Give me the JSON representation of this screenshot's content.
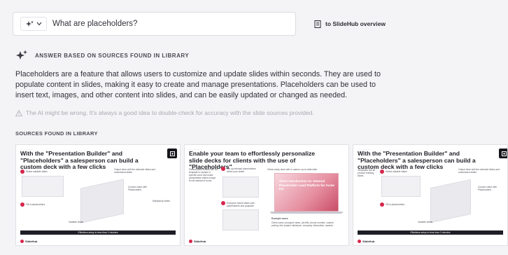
{
  "search": {
    "query": "What are placeholders?",
    "overview_link": "to SlideHub overview"
  },
  "answer": {
    "title": "ANSWER BASED ON SOURCES FOUND IN LIBRARY",
    "text": "Placeholders are a feature that allows users to customize and update slides within seconds. They are used to populate content in slides, making it easy to create and manage presentations. Placeholders can be used to insert text, images, and other content into slides, and can be easily updated or changed as needed.",
    "disclaimer": "The AI might be wrong. It's always a good idea to double-check for accuracy with the slide sources provided."
  },
  "sources": {
    "title": "SOURCES FOUND IN LIBRARY",
    "cards": [
      {
        "title": "With the \"Presentation Builder\" and \"Placeholders\" a salesperson can build a custom deck with a few clicks",
        "notes": [
          "Select suitable slides",
          "Output deck with the selected slides and customized slides",
          "Fill in placeholders",
          "Custom value with Placeholders",
          "Variable slides",
          "Mandatory slides"
        ],
        "footer": "Effortless setup in less than 2 minutes",
        "logo": "SlideHub"
      },
      {
        "title": "Enable your team to effortlessly personalize slide decks for clients with the use of \"Placeholders\"",
        "notes": [
          "Placeholders enable the 1st template to replace a specific word and make presentation slides unique for all instead of hours",
          "Set up relevant placeholders within your slides",
          "Client-ready deck with a custom, up-to-date data",
          "Everyone select slides with placeholders and populate",
          "Example cases",
          "Client name, prospect name, job title, phone number, custom pricing, firm project milestone, company information, awards"
        ],
        "slide_text": "Short introduction to: Internal Placeholder Lead Platform for Acme Inc",
        "logo": "SlideHub"
      },
      {
        "title": "With the \"Presentation Builder\" and \"Placeholders\" a salesperson can build a custom deck with a few clicks",
        "notes": [
          "Select suitable slides",
          "Output deck with the selected slides and customized slides",
          "Fill in placeholders",
          "Custom value with Placeholders",
          "Variable slides"
        ],
        "footer": "Effortless setup in less than 2 minutes",
        "logo": "SlideHub"
      }
    ]
  },
  "colors": {
    "accent": "#d7264b",
    "dark": "#1e1e26"
  },
  "icons": [
    "sparkle-icon",
    "chevron-down-icon",
    "document-icon",
    "warning-icon",
    "expand-icon"
  ]
}
